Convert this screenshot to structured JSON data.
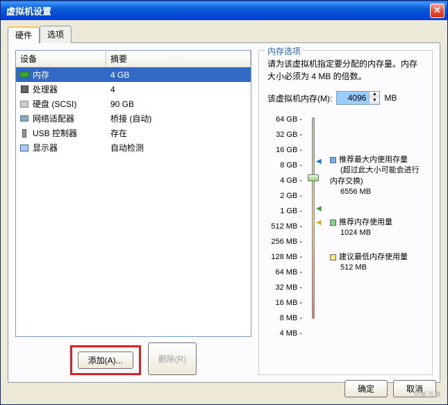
{
  "window": {
    "title": "虚拟机设置"
  },
  "tabs": {
    "hardware": "硬件",
    "options": "选项"
  },
  "table": {
    "header_device": "设备",
    "header_summary": "摘要",
    "rows": [
      {
        "name": "内存",
        "summary": "4 GB",
        "icon": "mem",
        "selected": true
      },
      {
        "name": "处理器",
        "summary": "4",
        "icon": "cpu"
      },
      {
        "name": "硬盘 (SCSI)",
        "summary": "90 GB",
        "icon": "hdd"
      },
      {
        "name": "网络适配器",
        "summary": "桥接 (自动)",
        "icon": "net"
      },
      {
        "name": "USB 控制器",
        "summary": "存在",
        "icon": "usb"
      },
      {
        "name": "显示器",
        "summary": "自动检测",
        "icon": "disp"
      }
    ]
  },
  "buttons": {
    "add": "添加(A)...",
    "remove": "删除(R)",
    "ok": "确定",
    "cancel": "取消"
  },
  "mem": {
    "group_title": "内存选项",
    "desc": "请为该虚拟机指定要分配的内存量。内存大小必须为 4 MB 的倍数。",
    "label": "该虚拟机内存(M):",
    "value": "4096",
    "unit": "MB",
    "scale": [
      "64 GB",
      "32 GB",
      "16 GB",
      "8 GB",
      "4 GB",
      "2 GB",
      "1 GB",
      "512 MB",
      "256 MB",
      "128 MB",
      "64 MB",
      "32 MB",
      "16 MB",
      "8 MB",
      "4 MB"
    ],
    "rec_max_label": "推荐最大内使用存量",
    "rec_max_sub": "(超过此大小可能会进行内存交换)",
    "rec_max_val": "6556 MB",
    "rec_label": "推荐内存使用量",
    "rec_val": "1024 MB",
    "min_label": "建议最低内存使用量",
    "min_val": "512 MB"
  },
  "watermark": "创新互联"
}
